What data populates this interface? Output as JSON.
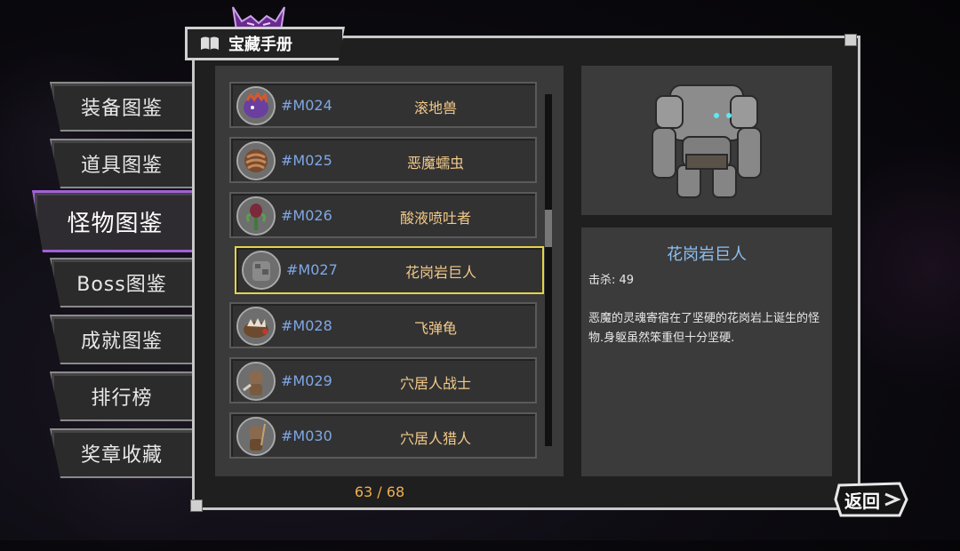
{
  "header": {
    "title": "宝藏手册",
    "book_icon": "book-icon"
  },
  "sidebar": {
    "items": [
      {
        "label": "装备图鉴"
      },
      {
        "label": "道具图鉴"
      },
      {
        "label": "怪物图鉴",
        "active": true
      },
      {
        "label": "Boss图鉴"
      },
      {
        "label": "成就图鉴"
      },
      {
        "label": "排行榜"
      },
      {
        "label": "奖章收藏"
      }
    ]
  },
  "list": {
    "rows": [
      {
        "code": "#M024",
        "name": "滚地兽",
        "icon": "purple-beast-avatar"
      },
      {
        "code": "#M025",
        "name": "恶魔蠕虫",
        "icon": "worm-avatar"
      },
      {
        "code": "#M026",
        "name": "酸液喷吐者",
        "icon": "plant-avatar"
      },
      {
        "code": "#M027",
        "name": "花岗岩巨人",
        "icon": "rock-golem-avatar",
        "selected": true
      },
      {
        "code": "#M028",
        "name": "飞弹龟",
        "icon": "turtle-avatar"
      },
      {
        "code": "#M029",
        "name": "穴居人战士",
        "icon": "caveman-warrior-avatar"
      },
      {
        "code": "#M030",
        "name": "穴居人猎人",
        "icon": "caveman-hunter-avatar"
      }
    ],
    "page_counter": "63 / 68"
  },
  "detail": {
    "name": "花岗岩巨人",
    "kills": "击杀: 49",
    "description": "恶魔的灵魂寄宿在了坚硬的花岗岩上诞生的怪物.身躯虽然笨重但十分坚硬."
  },
  "footer": {
    "back_label": "返回"
  },
  "colors": {
    "accent_purple": "#a060d8",
    "selected_border": "#e3d44a",
    "code_blue": "#7fa7e6",
    "name_gold": "#f2c98a",
    "title_blue": "#8cc0f2",
    "counter_orange": "#f0b050"
  }
}
